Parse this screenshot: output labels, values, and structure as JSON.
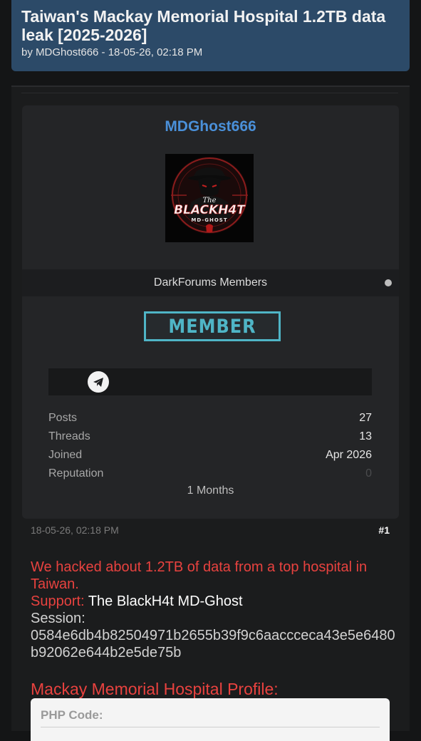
{
  "thread": {
    "title": "Taiwan's Mackay Memorial Hospital 1.2TB data leak [2025-2026]",
    "meta": "by MDGhost666 - 18-05-26, 02:18 PM"
  },
  "author": {
    "username": "MDGhost666",
    "avatar_text": {
      "line1": "The",
      "line2": "BLACKH4T",
      "line3": "MD-GHOST"
    },
    "group": "DarkForums Members",
    "badge": "MEMBER",
    "contact_icon": "telegram-icon",
    "stats": [
      {
        "label": "Posts",
        "value": "27"
      },
      {
        "label": "Threads",
        "value": "13"
      },
      {
        "label": "Joined",
        "value": "Apr 2026"
      },
      {
        "label": "Reputation",
        "value": "0"
      }
    ],
    "duration": "1 Months"
  },
  "post": {
    "date": "18-05-26, 02:18 PM",
    "number": "#1",
    "intro": "We hacked about 1.2TB of data from a top hospital in Taiwan.",
    "support_label": "Support:",
    "support_value": "The BlackH4t MD-Ghost",
    "session_label": "Session:",
    "session_value": "0584e6db4b82504971b2655b39f9c6aaccceca43e5e6480b92062e644b2e5de75b",
    "profile_heading": "Mackay Memorial Hospital Profile:",
    "code_label": "PHP Code:"
  },
  "colors": {
    "header_bg": "#2c4a68",
    "username": "#4a90d9",
    "badge": "#4fb5c6",
    "red_text": "#e8423f"
  }
}
